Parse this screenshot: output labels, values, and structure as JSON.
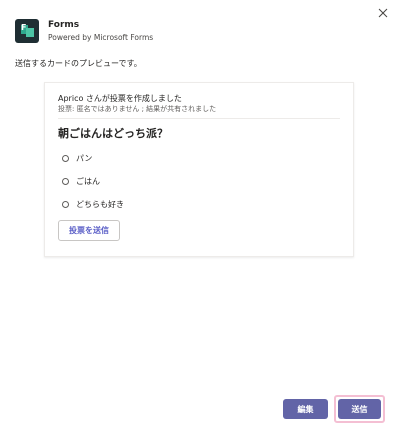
{
  "app": {
    "title": "Forms",
    "subtitle": "Powered by Microsoft Forms",
    "icon": "forms-app-icon",
    "icon_letter": "F"
  },
  "preview_label": "送信するカードのプレビューです。",
  "card": {
    "line1": "Aprico さんが投票を作成しました",
    "line2": "投票: 匿名ではありません ; 結果が共有されました",
    "question": "朝ごはんはどっち派？",
    "options": [
      "パン",
      "ごはん",
      "どちらも好き"
    ],
    "submit_label": "投票を送信"
  },
  "footer": {
    "edit_label": "編集",
    "send_label": "送信"
  },
  "colors": {
    "accent": "#6264a7",
    "highlight": "#f4bfd3"
  }
}
